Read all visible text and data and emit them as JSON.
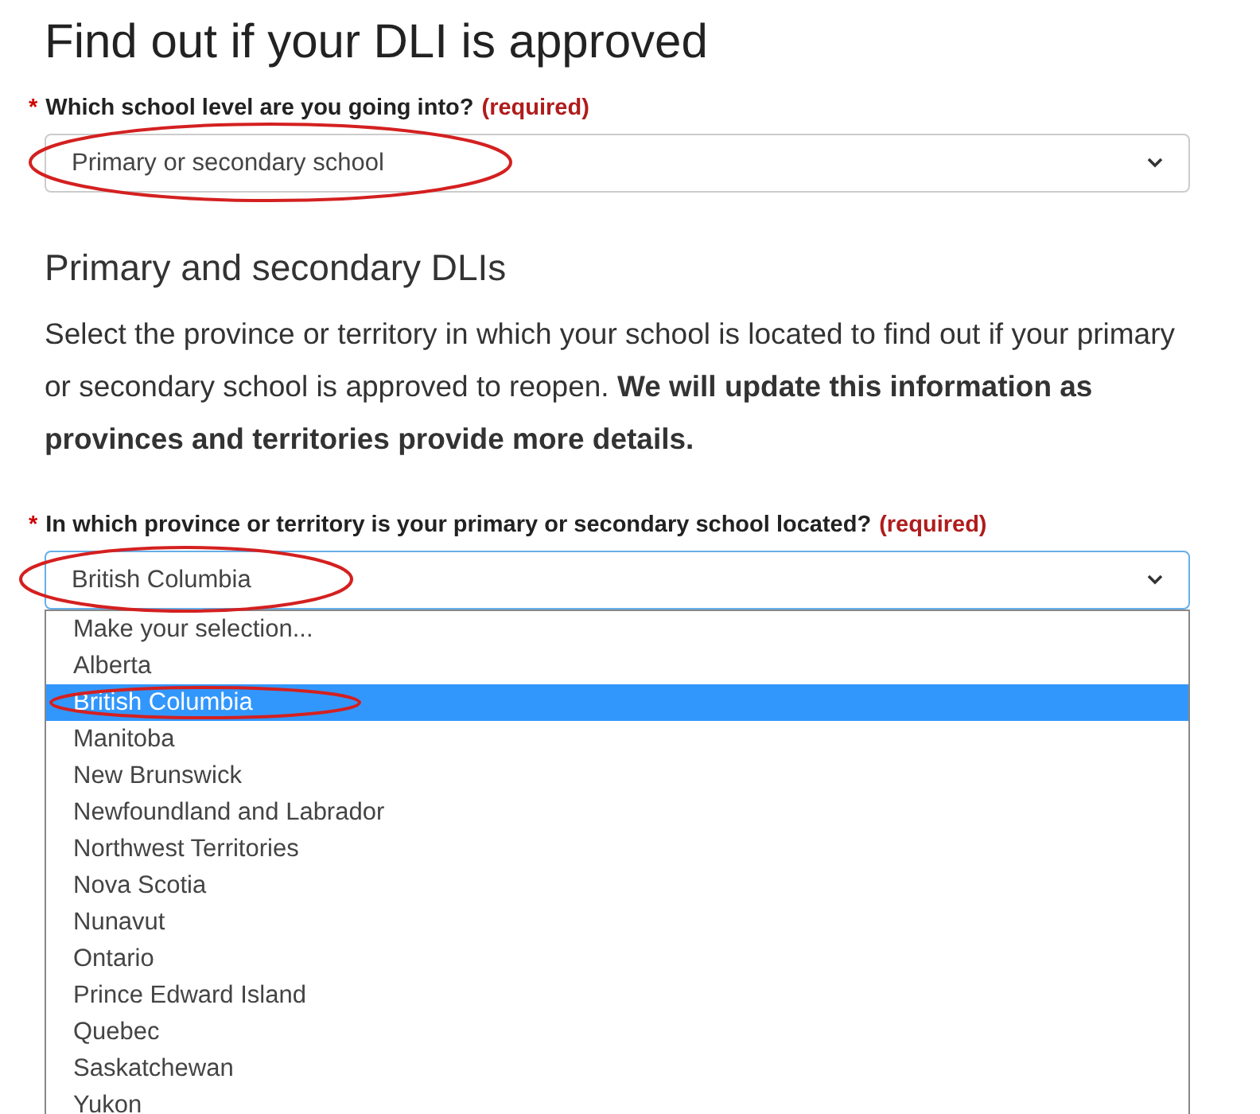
{
  "heading": "Find out if your DLI is approved",
  "school_level": {
    "required_mark": "*",
    "label": "Which school level are you going into?",
    "required_note": "(required)",
    "value": "Primary or secondary school",
    "circled": true
  },
  "section": {
    "title": "Primary and secondary DLIs",
    "text": "Select the province or territory in which your school is located to find out if your primary or secondary school is approved to reopen. **We will update this information as provinces and territories provide more details.**"
  },
  "province": {
    "required_mark": "*",
    "label": "In which province or territory is your primary or secondary school located?",
    "required_note": "(required)",
    "value": "British Columbia",
    "circled": true,
    "expanded": true,
    "options": [
      {
        "label": "Make your selection...",
        "selected": false,
        "circled": false
      },
      {
        "label": "Alberta",
        "selected": false,
        "circled": false
      },
      {
        "label": "British Columbia",
        "selected": true,
        "circled": true
      },
      {
        "label": "Manitoba",
        "selected": false,
        "circled": false
      },
      {
        "label": "New Brunswick",
        "selected": false,
        "circled": false
      },
      {
        "label": "Newfoundland and Labrador",
        "selected": false,
        "circled": false
      },
      {
        "label": "Northwest Territories",
        "selected": false,
        "circled": false
      },
      {
        "label": "Nova Scotia",
        "selected": false,
        "circled": false
      },
      {
        "label": "Nunavut",
        "selected": false,
        "circled": false
      },
      {
        "label": "Ontario",
        "selected": false,
        "circled": false
      },
      {
        "label": "Prince Edward Island",
        "selected": false,
        "circled": false
      },
      {
        "label": "Quebec",
        "selected": false,
        "circled": false
      },
      {
        "label": "Saskatchewan",
        "selected": false,
        "circled": false
      },
      {
        "label": "Yukon",
        "selected": false,
        "circled": false
      }
    ]
  }
}
